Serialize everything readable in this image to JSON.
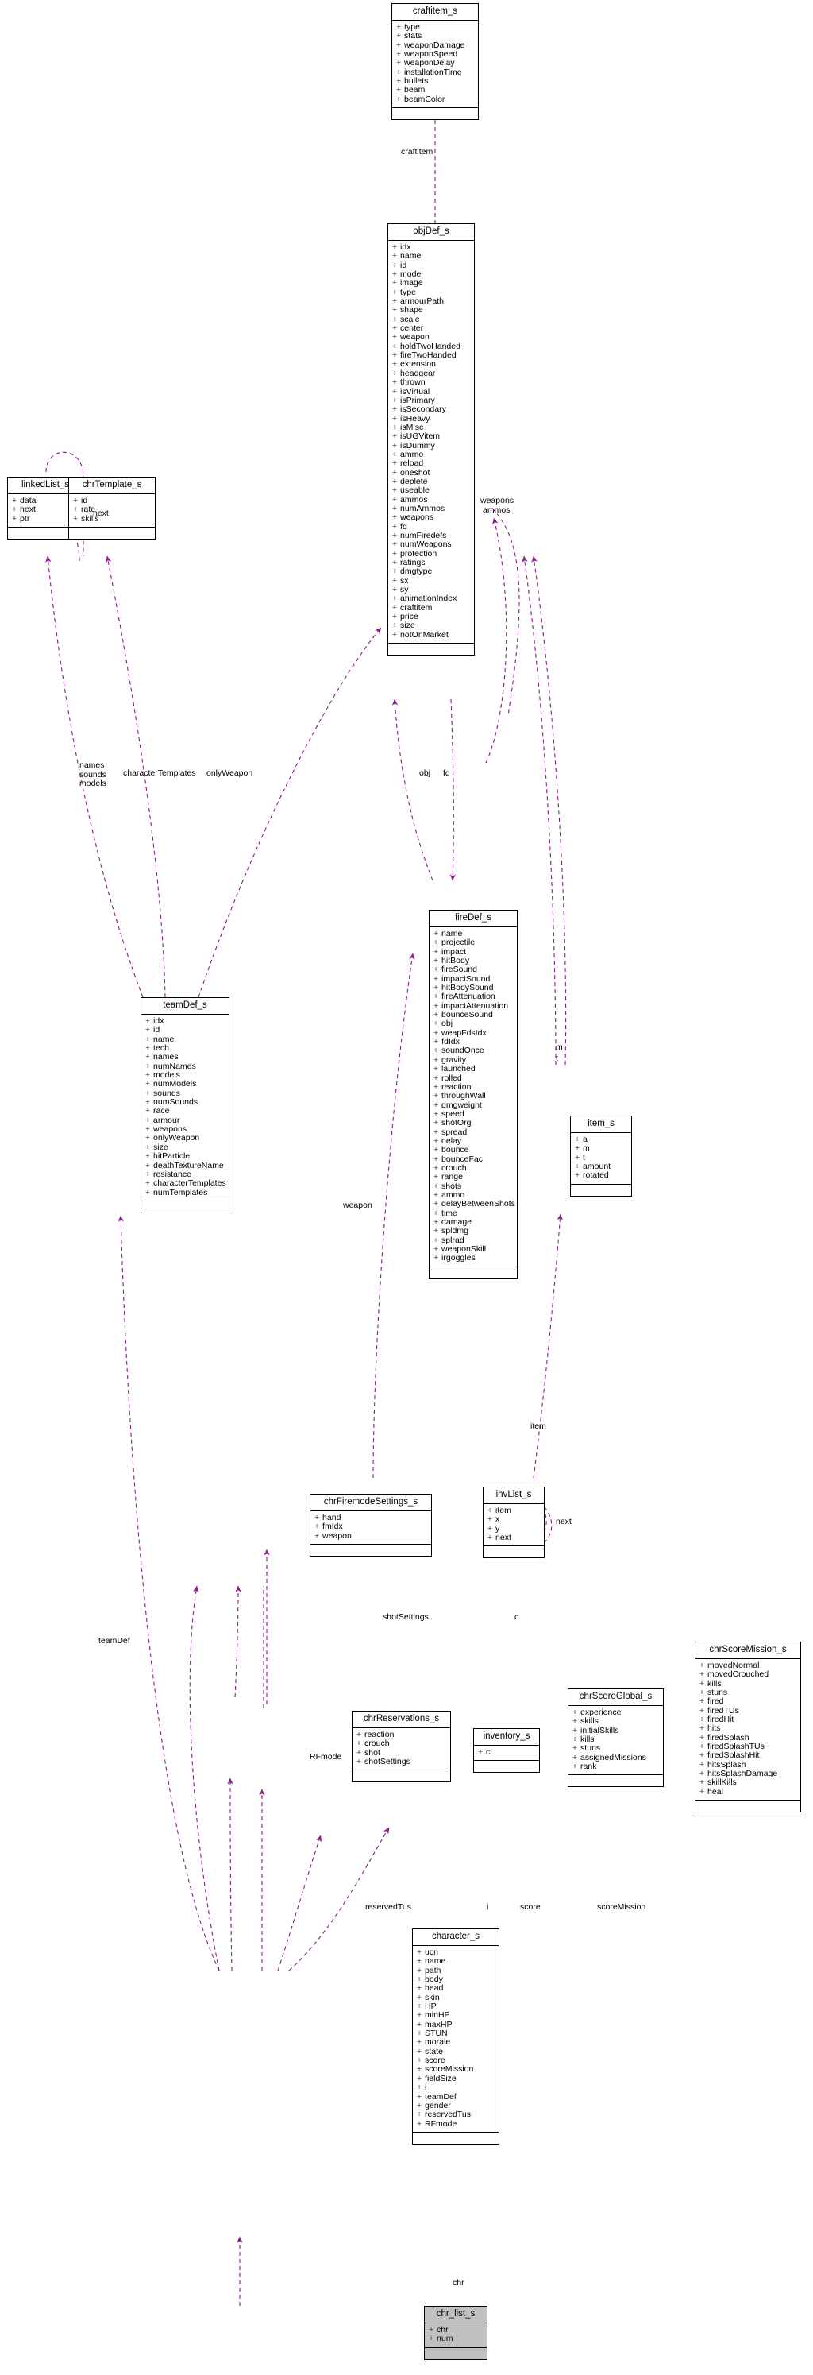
{
  "diagram": {
    "type": "uml-class-diagram",
    "edge_color": "#8b1a8b",
    "highlight_color": "#c0c0c0",
    "background": "#ffffff"
  },
  "nodes": {
    "craftitem_s": {
      "title": "craftitem_s",
      "attrs": [
        "type",
        "stats",
        "weaponDamage",
        "weaponSpeed",
        "weaponDelay",
        "installationTime",
        "bullets",
        "beam",
        "beamColor"
      ]
    },
    "objDef_s": {
      "title": "objDef_s",
      "attrs": [
        "idx",
        "name",
        "id",
        "model",
        "image",
        "type",
        "armourPath",
        "shape",
        "scale",
        "center",
        "weapon",
        "holdTwoHanded",
        "fireTwoHanded",
        "extension",
        "headgear",
        "thrown",
        "isVirtual",
        "isPrimary",
        "isSecondary",
        "isHeavy",
        "isMisc",
        "isUGVitem",
        "isDummy",
        "ammo",
        "reload",
        "oneshot",
        "deplete",
        "useable",
        "ammos",
        "numAmmos",
        "weapons",
        "fd",
        "numFiredefs",
        "numWeapons",
        "protection",
        "ratings",
        "dmgtype",
        "sx",
        "sy",
        "animationIndex",
        "craftitem",
        "price",
        "size",
        "notOnMarket"
      ]
    },
    "linkedList_s": {
      "title": "linkedList_s",
      "attrs": [
        "data",
        "next",
        "ptr"
      ]
    },
    "chrTemplate_s": {
      "title": "chrTemplate_s",
      "attrs": [
        "id",
        "rate",
        "skills"
      ]
    },
    "teamDef_s": {
      "title": "teamDef_s",
      "attrs": [
        "idx",
        "id",
        "name",
        "tech",
        "names",
        "numNames",
        "models",
        "numModels",
        "sounds",
        "numSounds",
        "race",
        "armour",
        "weapons",
        "onlyWeapon",
        "size",
        "hitParticle",
        "deathTextureName",
        "resistance",
        "characterTemplates",
        "numTemplates"
      ]
    },
    "fireDef_s": {
      "title": "fireDef_s",
      "attrs": [
        "name",
        "projectile",
        "impact",
        "hitBody",
        "fireSound",
        "impactSound",
        "hitBodySound",
        "fireAttenuation",
        "impactAttenuation",
        "bounceSound",
        "obj",
        "weapFdsIdx",
        "fdIdx",
        "soundOnce",
        "gravity",
        "launched",
        "rolled",
        "reaction",
        "throughWall",
        "dmgweight",
        "speed",
        "shotOrg",
        "spread",
        "delay",
        "bounce",
        "bounceFac",
        "crouch",
        "range",
        "shots",
        "ammo",
        "delayBetweenShots",
        "time",
        "damage",
        "spldmg",
        "splrad",
        "weaponSkill",
        "irgoggles"
      ]
    },
    "item_s": {
      "title": "item_s",
      "attrs": [
        "a",
        "m",
        "t",
        "amount",
        "rotated"
      ]
    },
    "chrFiremodeSettings_s": {
      "title": "chrFiremodeSettings_s",
      "attrs": [
        "hand",
        "fmIdx",
        "weapon"
      ]
    },
    "invList_s": {
      "title": "invList_s",
      "attrs": [
        "item",
        "x",
        "y",
        "next"
      ]
    },
    "chrReservations_s": {
      "title": "chrReservations_s",
      "attrs": [
        "reaction",
        "crouch",
        "shot",
        "shotSettings"
      ]
    },
    "inventory_s": {
      "title": "inventory_s",
      "attrs": [
        "c"
      ]
    },
    "chrScoreGlobal_s": {
      "title": "chrScoreGlobal_s",
      "attrs": [
        "experience",
        "skills",
        "initialSkills",
        "kills",
        "stuns",
        "assignedMissions",
        "rank"
      ]
    },
    "chrScoreMission_s": {
      "title": "chrScoreMission_s",
      "attrs": [
        "movedNormal",
        "movedCrouched",
        "kills",
        "stuns",
        "fired",
        "firedTUs",
        "firedHit",
        "hits",
        "firedSplash",
        "firedSplashTUs",
        "firedSplashHit",
        "hitsSplash",
        "hitsSplashDamage",
        "skillKills",
        "heal"
      ]
    },
    "character_s": {
      "title": "character_s",
      "attrs": [
        "ucn",
        "name",
        "path",
        "body",
        "head",
        "skin",
        "HP",
        "minHP",
        "maxHP",
        "STUN",
        "morale",
        "state",
        "score",
        "scoreMission",
        "fieldSize",
        "i",
        "teamDef",
        "gender",
        "reservedTus",
        "RFmode"
      ]
    },
    "chr_list_s": {
      "title": "chr_list_s",
      "attrs": [
        "chr",
        "num"
      ]
    }
  },
  "edge_labels": [
    {
      "id": "craftitem",
      "text": "craftitem"
    },
    {
      "id": "weapons",
      "text": "weapons"
    },
    {
      "id": "ammos",
      "text": "ammos"
    },
    {
      "id": "next-linkedlist",
      "text": "next"
    },
    {
      "id": "names-sounds-models",
      "text": "names\nsounds\nmodels"
    },
    {
      "id": "characterTemplates",
      "text": "characterTemplates"
    },
    {
      "id": "onlyWeapon",
      "text": "onlyWeapon"
    },
    {
      "id": "obj",
      "text": "obj"
    },
    {
      "id": "fd",
      "text": "fd"
    },
    {
      "id": "m",
      "text": "m"
    },
    {
      "id": "t",
      "text": "t"
    },
    {
      "id": "weapon",
      "text": "weapon"
    },
    {
      "id": "item",
      "text": "item"
    },
    {
      "id": "next-invlist",
      "text": "next"
    },
    {
      "id": "shotSettings",
      "text": "shotSettings"
    },
    {
      "id": "c",
      "text": "c"
    },
    {
      "id": "teamDef",
      "text": "teamDef"
    },
    {
      "id": "RFmode",
      "text": "RFmode"
    },
    {
      "id": "reservedTus",
      "text": "reservedTus"
    },
    {
      "id": "i",
      "text": "i"
    },
    {
      "id": "score",
      "text": "score"
    },
    {
      "id": "scoreMission",
      "text": "scoreMission"
    },
    {
      "id": "chr",
      "text": "chr"
    }
  ]
}
